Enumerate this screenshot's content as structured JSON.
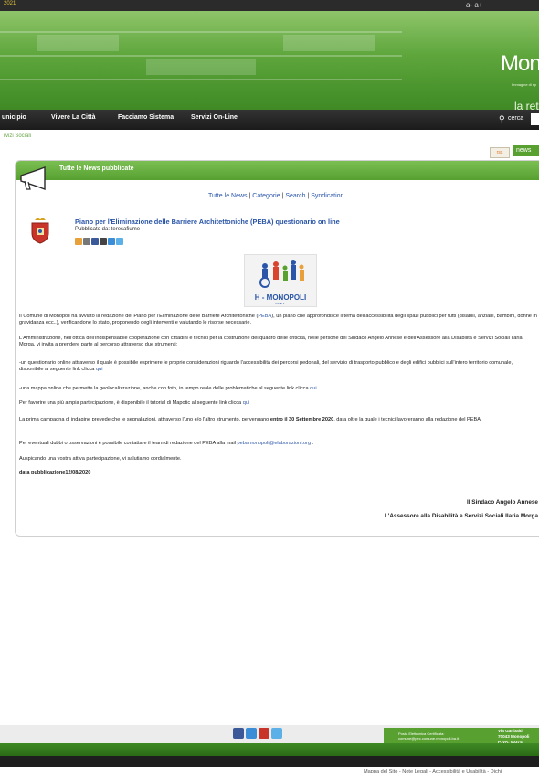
{
  "topbar": {
    "left_text": "2021",
    "right_text": "a- a+"
  },
  "header": {
    "brand": "Mon",
    "brand_subtitle": "Immagine di sp",
    "tagline": "la rete"
  },
  "nav": {
    "items": [
      {
        "label": "unicipio"
      },
      {
        "label": "Vivere La Città"
      },
      {
        "label": "Facciamo Sistema"
      },
      {
        "label": "Servizi On-Line"
      }
    ],
    "search_label": "cerca",
    "search_placeholder": ""
  },
  "breadcrumb": "rvizi Sociali",
  "right_buttons": {
    "rss": "rss",
    "news": "news"
  },
  "panel": {
    "title": "Tutte le News pubblicate",
    "links": {
      "all": "Tutte le News",
      "categories": "Categorie",
      "search": "Search",
      "syndication": "Syndication",
      "sep": " | "
    },
    "article": {
      "title": "Piano per l'Eliminazione delle Barriere Architettoniche (PEBA) questionario on line",
      "author": "Pubblicato da: teresafiume"
    },
    "logo": {
      "title": "H - MONOPOLI",
      "subtitle": "P.E.B.A."
    },
    "paragraphs": {
      "p1a": "Il Comune di Monopoli ha avviato la redazione del Piano per l'Eliminazione delle Barriere Architettoniche (",
      "p1b": "PEBA",
      "p1c": "), un piano che approfondisce il tema dell'accessibilità degli spazi pubblici per tutti (disabili, anziani, bambini, donne in gravidanza ecc..), verificandone lo stato, proponendo degli interventi e valutando le risorse necessarie.",
      "p2": "L'Amministrazione, nell'ottica dell'indispensabile cooperazione con cittadini e tecnici per la costruzione del quadro delle criticità, nelle persone del Sindaco Angelo Annese e dell'Assessore alla Disabilità e Servizi Sociali Ilaria Morga, vi invita a prendere parte al percorso attraverso due strumenti:",
      "p3": "-un questionario online attraverso il quale è possibile  esprimere le proprie considerazioni riguardo l'accessibilità dei percorsi pedonali, del servizio di trasporto pubblico e degli edifici pubblici sull'intero territorio comunale, disponibile al seguente link clicca ",
      "p4": "-una mappa online che permette la geolocalizzazione, anche con foto, in tempo reale delle problematiche al seguente link clicca ",
      "p5": "Per favorire una più ampia partecipazione, è disponibile il tutorial di Mapotic al seguente link clicca ",
      "p6a": "La prima campagna di indagine prevede che le segnalazioni, attraverso l'uno e/o l'altro strumento, pervengano ",
      "p6b": "entro il 30 Settembre 2020",
      "p6c": ", data oltre la quale i tecnici lavoreranno alla redazione del PEBA.",
      "p7a": "Per eventuali dubbi o osservazioni è possibile contattare il team di redazione del PEBA alla mail ",
      "p7b": "pebamonopoli@elaborazioni.org",
      "p7c": " .",
      "p8": "Auspicando una vostra attiva partecipazione, vi salutiamo cordialmente.",
      "p9": "data  pubblicazione12/08/2020",
      "link_text": "qui"
    },
    "signature_mayor": "Il Sindaco Angelo Annese",
    "signature_councillor": "L'Assessore alla Disabilità e Servizi Sociali Ilaria Morga"
  },
  "footer": {
    "pec_line1": "Posta Elettronica Certificata:",
    "pec_line2": "comune@pec.comune.monopoli.ba.it",
    "addr_line1": "Via Garibaldi",
    "addr_line2": "70043 Monopoli",
    "addr_line3": "P.IVA: 00374",
    "links": "Mappa del Sito - Note Legali - Accessibilità e Usabilità - Dichi"
  },
  "colors": {
    "green": "#58a030",
    "link": "#2a55a8",
    "dark": "#1e1e1e"
  }
}
